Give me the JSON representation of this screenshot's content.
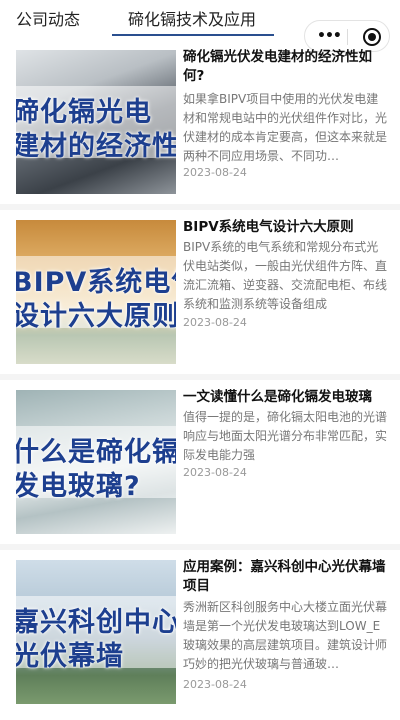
{
  "tabs": [
    {
      "label": "公司动态"
    },
    {
      "label": "碲化镉技术及应用"
    }
  ],
  "capsule": {
    "more_icon": "more-dots-icon",
    "close_icon": "target-icon"
  },
  "articles": [
    {
      "title": "碲化镉光伏发电建材的经济性如何?",
      "summary": "如果拿BIPV项目中使用的光伏发电建材和常规电站中的光伏组件作对比，光伏建材的成本肯定要高，但这本来就是两种不同应用场景、不同功…",
      "date": "2023-08-24",
      "thumb_lines": [
        "碲化镉光电",
        "建材的经济性"
      ]
    },
    {
      "title": "BIPV系统电气设计六大原则",
      "summary": "BIPV系统的电气系统和常规分布式光伏电站类似，一般由光伏组件方阵、直流汇流箱、逆变器、交流配电柜、布线系统和监测系统等设备组成",
      "date": "2023-08-24",
      "thumb_lines": [
        "BIPV系统电气",
        "设计六大原则"
      ]
    },
    {
      "title": "一文读懂什么是碲化镉发电玻璃",
      "summary": "值得一提的是，碲化镉太阳电池的光谱响应与地面太阳光谱分布非常匹配，实际发电能力强",
      "date": "2023-08-24",
      "thumb_lines": [
        "什么是碲化镉",
        "发电玻璃?"
      ]
    },
    {
      "title": "应用案例：嘉兴科创中心光伏幕墙项目",
      "summary": "秀洲新区科创服务中心大楼立面光伏幕墙是第一个光伏发电玻璃达到LOW_E玻璃效果的高层建筑项目。建筑设计师巧妙的把光伏玻璃与普通玻…",
      "date": "2023-08-24",
      "thumb_lines": [
        "嘉兴科创中心",
        "光伏幕墙"
      ]
    }
  ]
}
